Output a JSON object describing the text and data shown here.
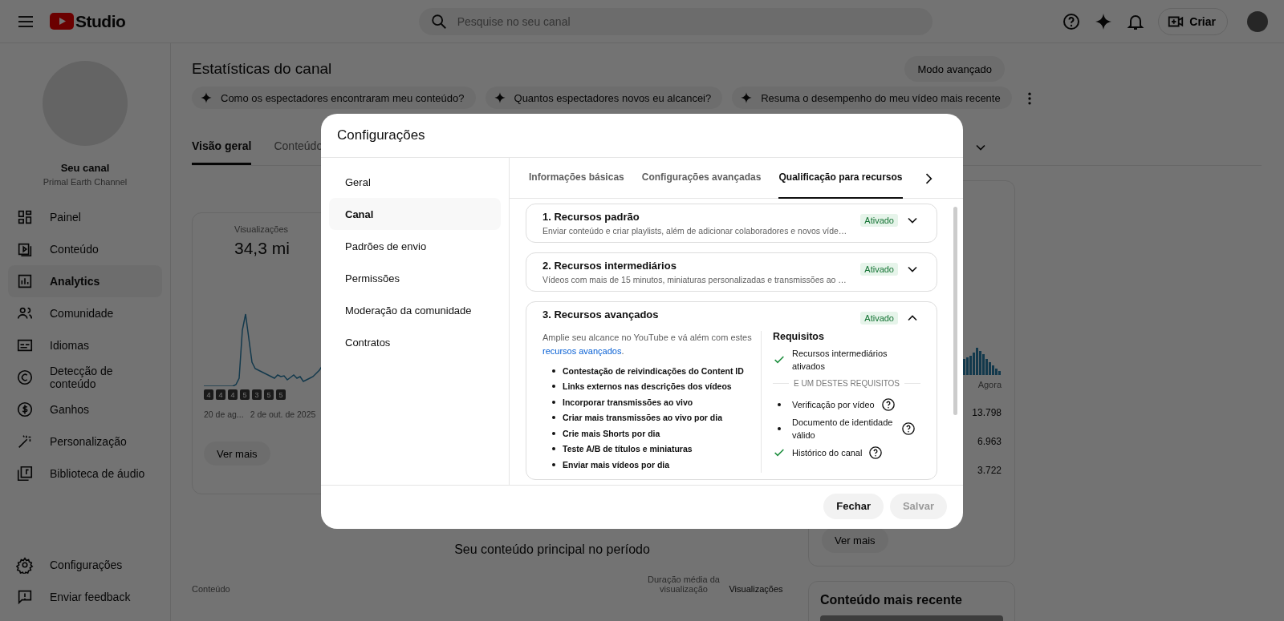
{
  "header": {
    "logo_text": "Studio",
    "search_placeholder": "Pesquise no seu canal",
    "create_button": "Criar"
  },
  "sidebar": {
    "channel_title": "Seu canal",
    "channel_name": "Primal Earth Channel",
    "items": [
      {
        "label": "Painel",
        "selected": false
      },
      {
        "label": "Conteúdo",
        "selected": false
      },
      {
        "label": "Analytics",
        "selected": true
      },
      {
        "label": "Comunidade",
        "selected": false
      },
      {
        "label": "Idiomas",
        "selected": false
      },
      {
        "label": "Detecção de conteúdo",
        "selected": false
      },
      {
        "label": "Ganhos",
        "selected": false
      },
      {
        "label": "Personalização",
        "selected": false
      },
      {
        "label": "Biblioteca de áudio",
        "selected": false
      }
    ],
    "footer_items": [
      "Configurações",
      "Enviar feedback"
    ]
  },
  "page": {
    "title": "Estatísticas do canal",
    "mode_button": "Modo avançado",
    "prompt_chips": [
      "Como os espectadores encontraram meu conteúdo?",
      "Quantos espectadores novos eu alcancei?",
      "Resuma o desempenho do meu vídeo mais recente"
    ],
    "tabs": [
      {
        "label": "Visão geral",
        "selected": true
      },
      {
        "label": "Conteúdo",
        "selected": false
      }
    ]
  },
  "views_card": {
    "label": "Visualizações",
    "value": "34,3 mi",
    "markers": [
      "4",
      "4",
      "4",
      "5",
      "3",
      "5",
      "5"
    ],
    "x_labels": [
      "20 de ag...",
      "2 de out. de 2025"
    ],
    "button": "Ver mais"
  },
  "side_card": {
    "x_label": "Agora",
    "values": [
      "13.798",
      "6.963",
      "3.722"
    ],
    "button": "Ver mais"
  },
  "recent_card": {
    "title": "Conteúdo mais recente"
  },
  "top_content": {
    "title": "Seu conteúdo principal no período",
    "columns": [
      "Conteúdo",
      "Duração média da visualização",
      "Visualizações"
    ]
  },
  "dialog": {
    "title": "Configurações",
    "nav": [
      {
        "label": "Geral",
        "selected": false
      },
      {
        "label": "Canal",
        "selected": true
      },
      {
        "label": "Padrões de envio",
        "selected": false
      },
      {
        "label": "Permissões",
        "selected": false
      },
      {
        "label": "Moderação da comunidade",
        "selected": false
      },
      {
        "label": "Contratos",
        "selected": false
      }
    ],
    "tabs": [
      {
        "label": "Informações básicas",
        "selected": false
      },
      {
        "label": "Configurações avançadas",
        "selected": false
      },
      {
        "label": "Qualificação para recursos",
        "selected": true
      }
    ],
    "sections": [
      {
        "title": "1. Recursos padrão",
        "description": "Enviar conteúdo e criar playlists, além de adicionar colaboradores e novos víde…",
        "status": "Ativado",
        "expanded": false
      },
      {
        "title": "2. Recursos intermediários",
        "description": "Vídeos com mais de 15 minutos, miniaturas personalizadas e transmissões ao …",
        "status": "Ativado",
        "expanded": false
      },
      {
        "title": "3. Recursos avançados",
        "status": "Ativado",
        "expanded": true,
        "intro": "Amplie seu alcance no YouTube e vá além com estes",
        "intro_link": "recursos avançados",
        "intro_end": ".",
        "features": [
          "Contestação de reivindicações do Content ID",
          "Links externos nas descrições dos vídeos",
          "Incorporar transmissões ao vivo",
          "Criar mais transmissões ao vivo por dia",
          "Crie mais Shorts por dia",
          "Teste A/B de títulos e miniaturas",
          "Enviar mais vídeos por dia"
        ],
        "requirements_title": "Requisitos",
        "requirements": [
          {
            "kind": "check",
            "text": "Recursos intermediários ativados",
            "help": false
          },
          {
            "kind": "divider",
            "text": "E UM DESTES REQUISITOS"
          },
          {
            "kind": "bullet",
            "text": "Verificação por vídeo",
            "help": true
          },
          {
            "kind": "bullet",
            "text": "Documento de identidade válido",
            "help": true
          },
          {
            "kind": "check",
            "text": "Histórico do canal",
            "help": true
          }
        ]
      }
    ],
    "buttons": [
      {
        "label": "Fechar",
        "disabled": false
      },
      {
        "label": "Salvar",
        "disabled": true
      }
    ]
  }
}
